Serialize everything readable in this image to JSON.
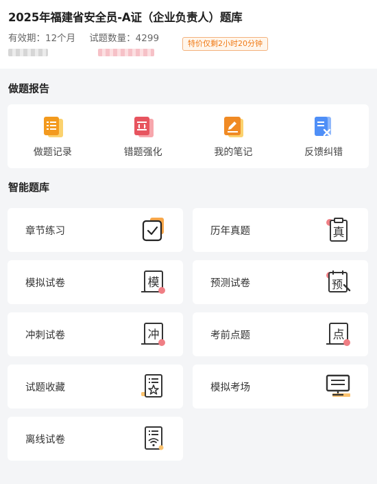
{
  "header": {
    "title": "2025年福建省安全员-A证（企业负责人）题库",
    "validity": "有效期：12个月",
    "question_count": "试题数量：4299",
    "promo": "特价仅剩2小时20分钟"
  },
  "report": {
    "section_title": "做题报告",
    "items": [
      {
        "label": "做题记录",
        "icon": "record-icon"
      },
      {
        "label": "错题强化",
        "icon": "wrong-question-icon"
      },
      {
        "label": "我的笔记",
        "icon": "note-icon"
      },
      {
        "label": "反馈纠错",
        "icon": "feedback-icon"
      }
    ]
  },
  "bank": {
    "section_title": "智能题库",
    "items": [
      {
        "label": "章节练习",
        "icon": "checkbox-doc-icon"
      },
      {
        "label": "历年真题",
        "icon": "clipboard-zhen-icon",
        "glyph": "真"
      },
      {
        "label": "模拟试卷",
        "icon": "scroll-mo-icon",
        "glyph": "模"
      },
      {
        "label": "预测试卷",
        "icon": "calendar-yu-icon",
        "glyph": "预"
      },
      {
        "label": "冲刺试卷",
        "icon": "scroll-chong-icon",
        "glyph": "冲"
      },
      {
        "label": "考前点题",
        "icon": "scroll-dian-icon",
        "glyph": "点"
      },
      {
        "label": "试题收藏",
        "icon": "star-doc-icon"
      },
      {
        "label": "模拟考场",
        "icon": "monitor-icon"
      },
      {
        "label": "离线试卷",
        "icon": "wifi-doc-icon"
      }
    ]
  },
  "colors": {
    "accent_orange": "#f39a1e",
    "accent_red": "#e7545f",
    "accent_blue": "#4f8ff7",
    "promo_text": "#f07a16"
  }
}
